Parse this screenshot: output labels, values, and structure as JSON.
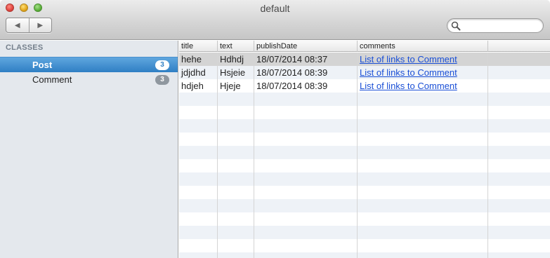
{
  "window": {
    "title": "default"
  },
  "toolbar": {
    "back_glyph": "◀",
    "forward_glyph": "▶",
    "search": {
      "value": "",
      "placeholder": ""
    }
  },
  "sidebar": {
    "heading": "CLASSES",
    "items": [
      {
        "label": "Post",
        "count": "3",
        "selected": true
      },
      {
        "label": "Comment",
        "count": "3",
        "selected": false
      }
    ]
  },
  "table": {
    "columns": [
      "title",
      "text",
      "publishDate",
      "comments",
      ""
    ],
    "rows": [
      {
        "title": "hehe",
        "text": "Hdhdj",
        "publishDate": "18/07/2014 08:37",
        "comments": "List of links to Comment"
      },
      {
        "title": "jdjdhd",
        "text": "Hsjeie",
        "publishDate": "18/07/2014 08:39",
        "comments": "List of links to Comment"
      },
      {
        "title": "hdjeh",
        "text": "Hjeje",
        "publishDate": "18/07/2014 08:39",
        "comments": "List of links to Comment"
      }
    ],
    "selected_row": 0
  },
  "colors": {
    "selection": "#2f7fc4",
    "link": "#1a4fd6",
    "sidebar_bg": "#e4e8ed",
    "row_alt": "#eef2f7"
  },
  "icons": [
    "close-button",
    "minimize-button",
    "zoom-button",
    "back-arrow-icon",
    "forward-arrow-icon",
    "search-icon"
  ]
}
